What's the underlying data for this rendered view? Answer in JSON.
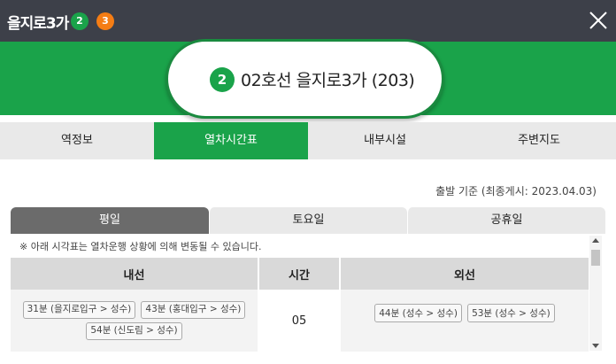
{
  "header": {
    "title": "을지로3가",
    "lines": [
      {
        "num": "2",
        "color": "#1aa34a"
      },
      {
        "num": "3",
        "color": "#f57d14"
      }
    ]
  },
  "station": {
    "line_num": "2",
    "name": "02호선 을지로3가 (203)"
  },
  "tabs": [
    {
      "label": "역정보",
      "active": false
    },
    {
      "label": "열차시간표",
      "active": true
    },
    {
      "label": "내부시설",
      "active": false
    },
    {
      "label": "주변지도",
      "active": false
    }
  ],
  "basis": "출발 기준 (최종게시: 2023.04.03)",
  "day_tabs": [
    {
      "label": "평일",
      "active": true
    },
    {
      "label": "토요일",
      "active": false
    },
    {
      "label": "공휴일",
      "active": false
    }
  ],
  "notice": "※ 아래 시각표는 열차운행 상황에 의해 변동될 수 있습니다.",
  "timetable": {
    "headers": [
      "내선",
      "시간",
      "외선"
    ],
    "rows": [
      {
        "hour": "05",
        "inner": [
          "31분 (을지로입구 > 성수)",
          "43분 (홍대입구 > 성수)",
          "54분 (신도림 > 성수)"
        ],
        "outer": [
          "44분 (성수 > 성수)",
          "53분 (성수 > 성수)"
        ]
      }
    ]
  }
}
